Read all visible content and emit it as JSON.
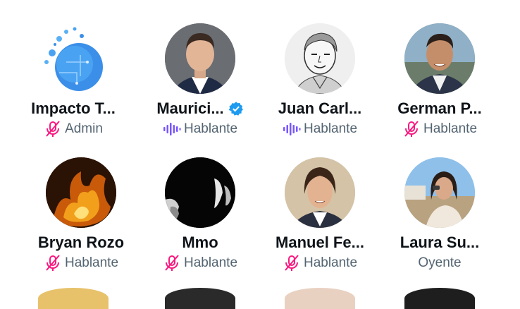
{
  "colors": {
    "accent_purple": "#7856ff",
    "muted_pink": "#f91880",
    "verified_blue": "#1d9bf0",
    "text_primary": "#0f1419",
    "text_secondary": "#536471"
  },
  "participants": [
    {
      "name": "Impacto T...",
      "role": "Admin",
      "role_icon": "mic-muted-icon",
      "verified": false
    },
    {
      "name": "Maurici...",
      "role": "Hablante",
      "role_icon": "speaking-waveform-icon",
      "verified": true
    },
    {
      "name": "Juan Carl...",
      "role": "Hablante",
      "role_icon": "speaking-waveform-icon",
      "verified": false
    },
    {
      "name": "German P...",
      "role": "Hablante",
      "role_icon": "mic-muted-icon",
      "verified": false
    },
    {
      "name": "Bryan Rozo",
      "role": "Hablante",
      "role_icon": "mic-muted-icon",
      "verified": false
    },
    {
      "name": "Mmo",
      "role": "Hablante",
      "role_icon": "mic-muted-icon",
      "verified": false
    },
    {
      "name": "Manuel Fe...",
      "role": "Hablante",
      "role_icon": "mic-muted-icon",
      "verified": false
    },
    {
      "name": "Laura  Su...",
      "role": "Oyente",
      "role_icon": "",
      "verified": false
    }
  ]
}
